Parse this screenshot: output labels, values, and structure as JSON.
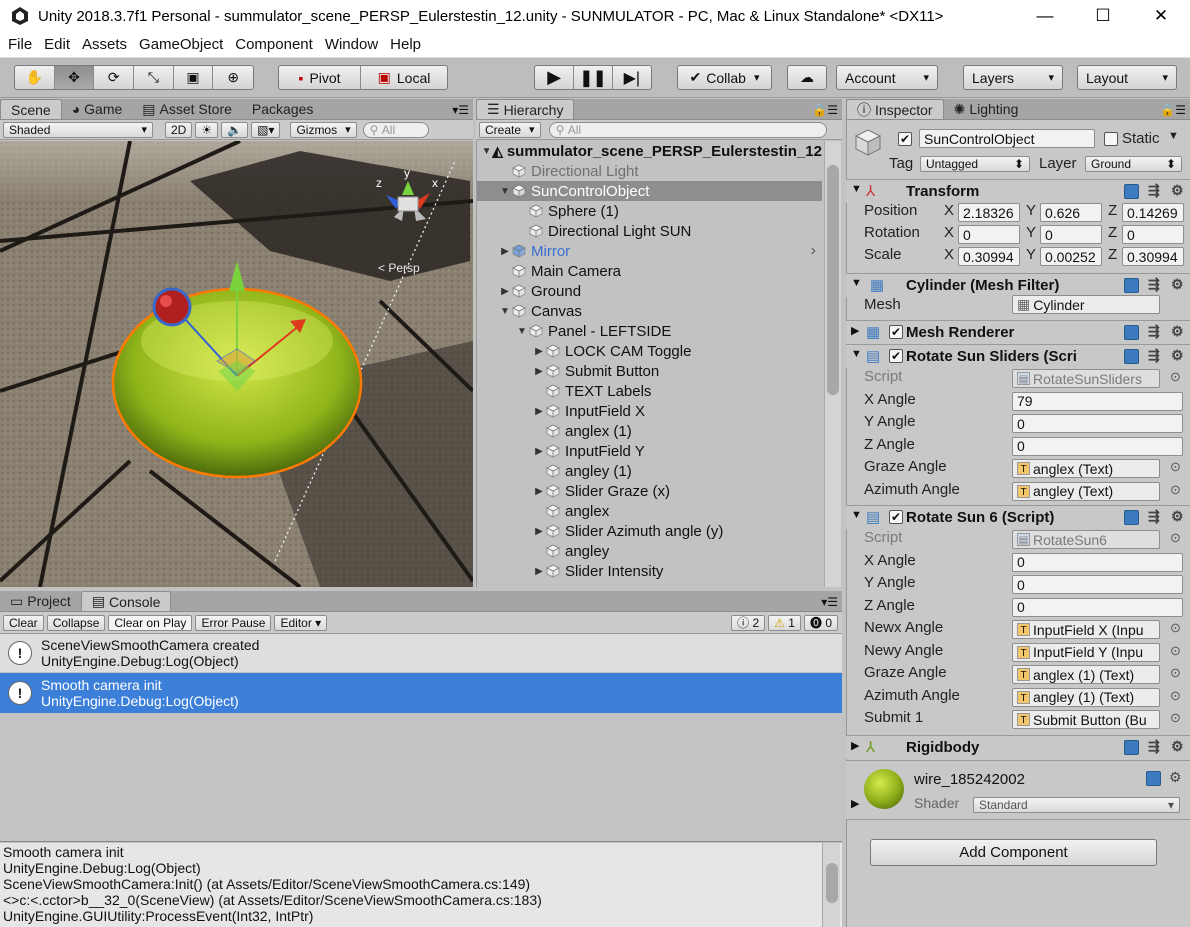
{
  "window": {
    "title": "Unity 2018.3.7f1 Personal - summulator_scene_PERSP_Eulerstestin_12.unity - SUNMULATOR - PC, Mac & Linux Standalone* <DX11>",
    "minimize": "—",
    "maximize": "☐",
    "close": "✕"
  },
  "menu": [
    "File",
    "Edit",
    "Assets",
    "GameObject",
    "Component",
    "Window",
    "Help"
  ],
  "toolbar": {
    "pivot": "Pivot",
    "local": "Local",
    "collab": "Collab",
    "account": "Account",
    "layers": "Layers",
    "layout": "Layout"
  },
  "scene": {
    "tabs": [
      "Scene",
      "Game",
      "Asset Store",
      "Packages"
    ],
    "shading": "Shaded",
    "mode2d": "2D",
    "gizmos": "Gizmos",
    "search_placeholder": "All",
    "persp": "< Persp"
  },
  "hierarchy": {
    "tab": "Hierarchy",
    "create": "Create",
    "search_placeholder": "All",
    "scene_name": "summulator_scene_PERSP_Eulerstestin_12",
    "rows": [
      {
        "label": "Directional Light",
        "indent": 1,
        "arrow": "",
        "style": "faded"
      },
      {
        "label": "SunControlObject",
        "indent": 1,
        "arrow": "▼",
        "style": "selected"
      },
      {
        "label": "Sphere (1)",
        "indent": 2,
        "arrow": "",
        "style": ""
      },
      {
        "label": "Directional Light SUN",
        "indent": 2,
        "arrow": "",
        "style": ""
      },
      {
        "label": "Mirror",
        "indent": 1,
        "arrow": "▶",
        "style": "prefab"
      },
      {
        "label": "Main Camera",
        "indent": 1,
        "arrow": "",
        "style": ""
      },
      {
        "label": "Ground",
        "indent": 1,
        "arrow": "▶",
        "style": ""
      },
      {
        "label": "Canvas",
        "indent": 1,
        "arrow": "▼",
        "style": ""
      },
      {
        "label": "Panel - LEFTSIDE",
        "indent": 2,
        "arrow": "▼",
        "style": ""
      },
      {
        "label": "LOCK CAM Toggle",
        "indent": 3,
        "arrow": "▶",
        "style": ""
      },
      {
        "label": "Submit Button",
        "indent": 3,
        "arrow": "▶",
        "style": ""
      },
      {
        "label": "TEXT Labels",
        "indent": 3,
        "arrow": "",
        "style": ""
      },
      {
        "label": "InputField X",
        "indent": 3,
        "arrow": "▶",
        "style": ""
      },
      {
        "label": "anglex (1)",
        "indent": 3,
        "arrow": "",
        "style": ""
      },
      {
        "label": "InputField Y",
        "indent": 3,
        "arrow": "▶",
        "style": ""
      },
      {
        "label": "angley (1)",
        "indent": 3,
        "arrow": "",
        "style": ""
      },
      {
        "label": "Slider Graze (x)",
        "indent": 3,
        "arrow": "▶",
        "style": ""
      },
      {
        "label": "anglex",
        "indent": 3,
        "arrow": "",
        "style": ""
      },
      {
        "label": "Slider Azimuth angle  (y)",
        "indent": 3,
        "arrow": "▶",
        "style": ""
      },
      {
        "label": "angley",
        "indent": 3,
        "arrow": "",
        "style": ""
      },
      {
        "label": "Slider Intensity",
        "indent": 3,
        "arrow": "▶",
        "style": ""
      }
    ]
  },
  "inspector": {
    "tabs": [
      "Inspector",
      "Lighting"
    ],
    "object_name": "SunControlObject",
    "static": "Static",
    "tag_label": "Tag",
    "tag": "Untagged",
    "layer_label": "Layer",
    "layer": "Ground",
    "transform": {
      "title": "Transform",
      "position_label": "Position",
      "rotation_label": "Rotation",
      "scale_label": "Scale",
      "position": [
        "2.18326",
        "0.626",
        "0.14269"
      ],
      "rotation": [
        "0",
        "0",
        "0"
      ],
      "scale": [
        "0.30994",
        "0.00252",
        "0.30994"
      ],
      "axes": [
        "X",
        "Y",
        "Z"
      ]
    },
    "mesh_filter": {
      "title": "Cylinder (Mesh Filter)",
      "mesh_label": "Mesh",
      "mesh": "Cylinder"
    },
    "mesh_renderer": {
      "title": "Mesh Renderer"
    },
    "rotate_sliders": {
      "title": "Rotate Sun Sliders (Scri",
      "rows": [
        {
          "label": "Script",
          "value": "RotateSunSliders",
          "kind": "ro"
        },
        {
          "label": "X Angle",
          "value": "79",
          "kind": "num"
        },
        {
          "label": "Y Angle",
          "value": "0",
          "kind": "num"
        },
        {
          "label": "Z Angle",
          "value": "0",
          "kind": "num"
        },
        {
          "label": "Graze Angle",
          "value": "anglex (Text)",
          "kind": "obj"
        },
        {
          "label": "Azimuth Angle",
          "value": "angley (Text)",
          "kind": "obj"
        }
      ]
    },
    "rotate_sun6": {
      "title": "Rotate Sun 6 (Script)",
      "rows": [
        {
          "label": "Script",
          "value": "RotateSun6",
          "kind": "ro"
        },
        {
          "label": "X Angle",
          "value": "0",
          "kind": "num"
        },
        {
          "label": "Y Angle",
          "value": "0",
          "kind": "num"
        },
        {
          "label": "Z Angle",
          "value": "0",
          "kind": "num"
        },
        {
          "label": "Newx Angle",
          "value": "InputField X (Inpu",
          "kind": "obj"
        },
        {
          "label": "Newy Angle",
          "value": "InputField Y (Inpu",
          "kind": "obj"
        },
        {
          "label": "Graze Angle",
          "value": "anglex (1) (Text)",
          "kind": "obj"
        },
        {
          "label": "Azimuth Angle",
          "value": "angley (1) (Text)",
          "kind": "obj"
        },
        {
          "label": "Submit 1",
          "value": "Submit Button (Bu",
          "kind": "obj"
        }
      ]
    },
    "rigidbody": {
      "title": "Rigidbody"
    },
    "material": {
      "name": "wire_185242002",
      "shader_label": "Shader",
      "shader": "Standard"
    },
    "add_component": "Add Component"
  },
  "console": {
    "tabs": [
      "Project",
      "Console"
    ],
    "buttons": [
      "Clear",
      "Collapse",
      "Clear on Play",
      "Error Pause",
      "Editor"
    ],
    "counts": {
      "info": "2",
      "warn": "1",
      "error": "0"
    },
    "entries": [
      {
        "line1": "SceneViewSmoothCamera created",
        "line2": "UnityEngine.Debug:Log(Object)"
      },
      {
        "line1": "Smooth camera init",
        "line2": "UnityEngine.Debug:Log(Object)"
      }
    ],
    "detail": [
      "Smooth camera init",
      "UnityEngine.Debug:Log(Object)",
      "SceneViewSmoothCamera:Init() (at Assets/Editor/SceneViewSmoothCamera.cs:149)",
      "<>c:<.cctor>b__32_0(SceneView) (at Assets/Editor/SceneViewSmoothCamera.cs:183)",
      "UnityEngine.GUIUtility:ProcessEvent(Int32, IntPtr)"
    ]
  },
  "colors": {
    "selection": "#3b7fd9",
    "hier_selected": "#8e8e8e",
    "disk": "#a6c21a",
    "outline": "#ff7a00"
  }
}
